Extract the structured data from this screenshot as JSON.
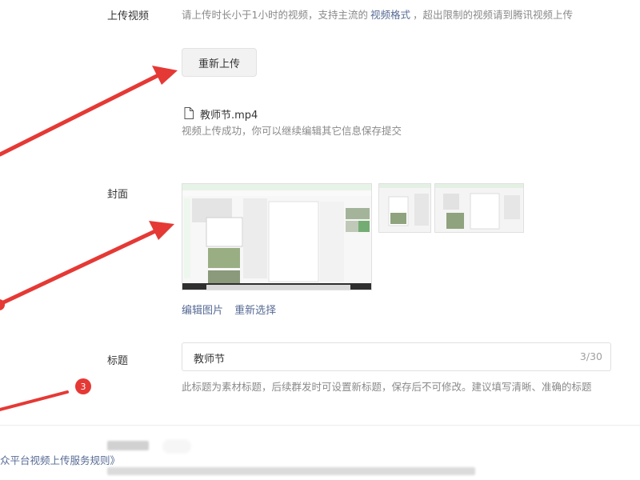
{
  "upload_video": {
    "label": "上传视频",
    "desc_part1": "请上传时长小于1小时的视频，支持主流的",
    "desc_link": "视频格式",
    "desc_part2": "，超出限制的视频请到腾讯视频上传",
    "reupload_button": "重新上传",
    "file_name": "教师节.mp4",
    "success_text": "视频上传成功，你可以继续编辑其它信息保存提交"
  },
  "cover": {
    "label": "封面",
    "edit_image_link": "编辑图片",
    "reselect_link": "重新选择",
    "thumbnails": [
      "cover-main",
      "cover-alt-1",
      "cover-alt-2"
    ]
  },
  "title_field": {
    "label": "标题",
    "value": "教师节",
    "counter": "3/30",
    "hint": "此标题为素材标题，后续群发时可设置新标题，保存后不可修改。建议填写清晰、准确的标题"
  },
  "annotation": {
    "badge_number": "3"
  },
  "footer": {
    "rules_link": "众平台视频上传服务规则》"
  },
  "colors": {
    "link": "#576b95",
    "arrow_red": "#e53935"
  }
}
